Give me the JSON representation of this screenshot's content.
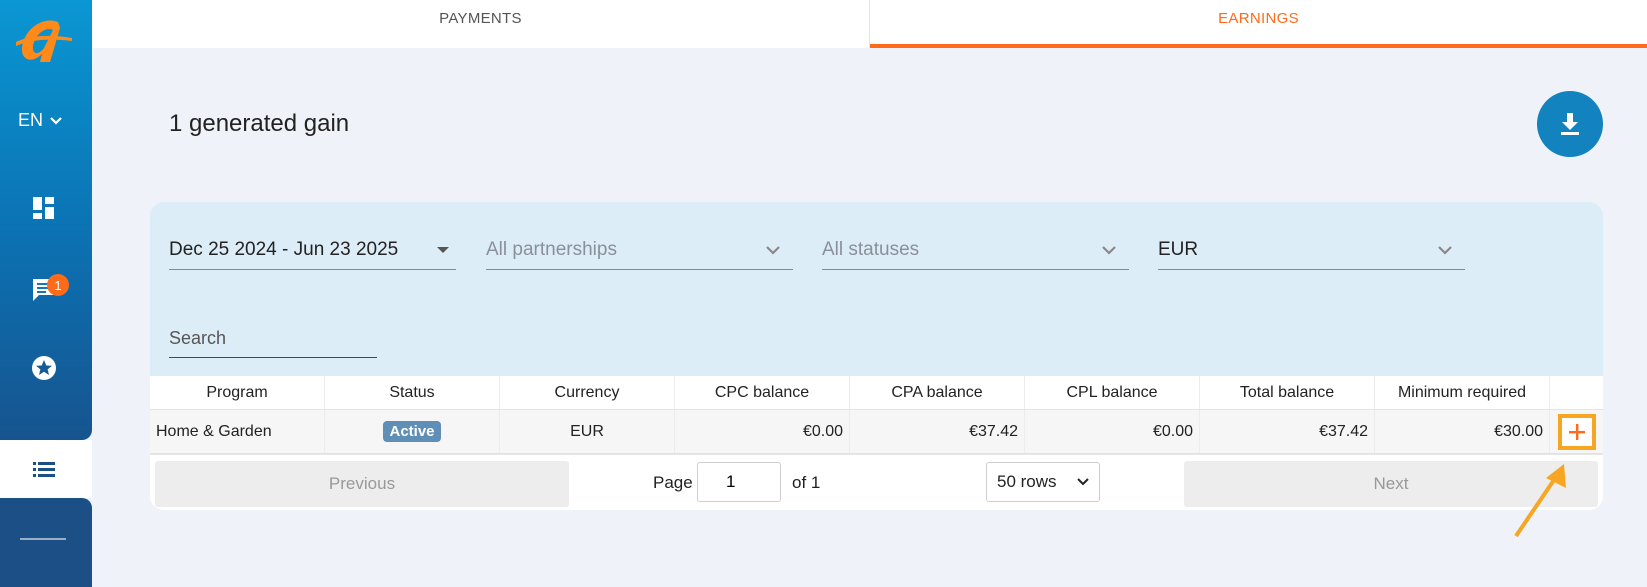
{
  "sidebar": {
    "language": "EN",
    "notifications_count": "1",
    "icons": [
      "logo-icon",
      "dashboard-icon",
      "chat-icon",
      "star-badge-icon",
      "list-icon",
      "menu-line-icon"
    ]
  },
  "tabs": [
    {
      "label": "PAYMENTS",
      "active": false
    },
    {
      "label": "EARNINGS",
      "active": true
    }
  ],
  "page": {
    "title": "1 generated gain"
  },
  "filters": {
    "date_range": "Dec 25 2024 - Jun 23 2025",
    "partnerships": "All partnerships",
    "statuses": "All statuses",
    "currency": "EUR",
    "search_placeholder": "Search"
  },
  "table": {
    "headers": [
      "Program",
      "Status",
      "Currency",
      "CPC balance",
      "CPA balance",
      "CPL balance",
      "Total balance",
      "Minimum required"
    ],
    "rows": [
      {
        "program": "Home & Garden",
        "status": "Active",
        "currency": "EUR",
        "cpc": "€0.00",
        "cpa": "€37.42",
        "cpl": "€0.00",
        "total": "€37.42",
        "minimum": "€30.00"
      }
    ]
  },
  "pagination": {
    "previous": "Previous",
    "page_label": "Page",
    "page_value": "1",
    "of_label": "of 1",
    "rows_option": "50 rows",
    "next": "Next"
  },
  "colors": {
    "accent": "#ff6b1a",
    "primary": "#1283be",
    "highlight": "#f6a623"
  }
}
